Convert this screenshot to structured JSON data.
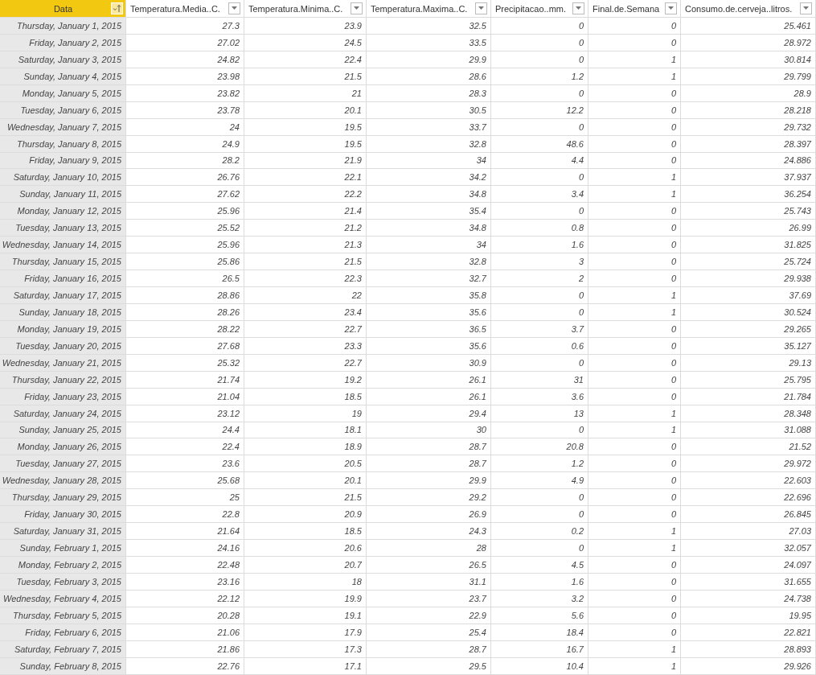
{
  "table": {
    "columns": [
      {
        "label": "Data",
        "selected": true
      },
      {
        "label": "Temperatura.Media..C.",
        "selected": false
      },
      {
        "label": "Temperatura.Minima..C.",
        "selected": false
      },
      {
        "label": "Temperatura.Maxima..C.",
        "selected": false
      },
      {
        "label": "Precipitacao..mm.",
        "selected": false
      },
      {
        "label": "Final.de.Semana",
        "selected": false
      },
      {
        "label": "Consumo.de.cerveja..litros.",
        "selected": false
      }
    ],
    "rows": [
      [
        "Thursday, January 1, 2015",
        "27.3",
        "23.9",
        "32.5",
        "0",
        "0",
        "25.461"
      ],
      [
        "Friday, January 2, 2015",
        "27.02",
        "24.5",
        "33.5",
        "0",
        "0",
        "28.972"
      ],
      [
        "Saturday, January 3, 2015",
        "24.82",
        "22.4",
        "29.9",
        "0",
        "1",
        "30.814"
      ],
      [
        "Sunday, January 4, 2015",
        "23.98",
        "21.5",
        "28.6",
        "1.2",
        "1",
        "29.799"
      ],
      [
        "Monday, January 5, 2015",
        "23.82",
        "21",
        "28.3",
        "0",
        "0",
        "28.9"
      ],
      [
        "Tuesday, January 6, 2015",
        "23.78",
        "20.1",
        "30.5",
        "12.2",
        "0",
        "28.218"
      ],
      [
        "Wednesday, January 7, 2015",
        "24",
        "19.5",
        "33.7",
        "0",
        "0",
        "29.732"
      ],
      [
        "Thursday, January 8, 2015",
        "24.9",
        "19.5",
        "32.8",
        "48.6",
        "0",
        "28.397"
      ],
      [
        "Friday, January 9, 2015",
        "28.2",
        "21.9",
        "34",
        "4.4",
        "0",
        "24.886"
      ],
      [
        "Saturday, January 10, 2015",
        "26.76",
        "22.1",
        "34.2",
        "0",
        "1",
        "37.937"
      ],
      [
        "Sunday, January 11, 2015",
        "27.62",
        "22.2",
        "34.8",
        "3.4",
        "1",
        "36.254"
      ],
      [
        "Monday, January 12, 2015",
        "25.96",
        "21.4",
        "35.4",
        "0",
        "0",
        "25.743"
      ],
      [
        "Tuesday, January 13, 2015",
        "25.52",
        "21.2",
        "34.8",
        "0.8",
        "0",
        "26.99"
      ],
      [
        "Wednesday, January 14, 2015",
        "25.96",
        "21.3",
        "34",
        "1.6",
        "0",
        "31.825"
      ],
      [
        "Thursday, January 15, 2015",
        "25.86",
        "21.5",
        "32.8",
        "3",
        "0",
        "25.724"
      ],
      [
        "Friday, January 16, 2015",
        "26.5",
        "22.3",
        "32.7",
        "2",
        "0",
        "29.938"
      ],
      [
        "Saturday, January 17, 2015",
        "28.86",
        "22",
        "35.8",
        "0",
        "1",
        "37.69"
      ],
      [
        "Sunday, January 18, 2015",
        "28.26",
        "23.4",
        "35.6",
        "0",
        "1",
        "30.524"
      ],
      [
        "Monday, January 19, 2015",
        "28.22",
        "22.7",
        "36.5",
        "3.7",
        "0",
        "29.265"
      ],
      [
        "Tuesday, January 20, 2015",
        "27.68",
        "23.3",
        "35.6",
        "0.6",
        "0",
        "35.127"
      ],
      [
        "Wednesday, January 21, 2015",
        "25.32",
        "22.7",
        "30.9",
        "0",
        "0",
        "29.13"
      ],
      [
        "Thursday, January 22, 2015",
        "21.74",
        "19.2",
        "26.1",
        "31",
        "0",
        "25.795"
      ],
      [
        "Friday, January 23, 2015",
        "21.04",
        "18.5",
        "26.1",
        "3.6",
        "0",
        "21.784"
      ],
      [
        "Saturday, January 24, 2015",
        "23.12",
        "19",
        "29.4",
        "13",
        "1",
        "28.348"
      ],
      [
        "Sunday, January 25, 2015",
        "24.4",
        "18.1",
        "30",
        "0",
        "1",
        "31.088"
      ],
      [
        "Monday, January 26, 2015",
        "22.4",
        "18.9",
        "28.7",
        "20.8",
        "0",
        "21.52"
      ],
      [
        "Tuesday, January 27, 2015",
        "23.6",
        "20.5",
        "28.7",
        "1.2",
        "0",
        "29.972"
      ],
      [
        "Wednesday, January 28, 2015",
        "25.68",
        "20.1",
        "29.9",
        "4.9",
        "0",
        "22.603"
      ],
      [
        "Thursday, January 29, 2015",
        "25",
        "21.5",
        "29.2",
        "0",
        "0",
        "22.696"
      ],
      [
        "Friday, January 30, 2015",
        "22.8",
        "20.9",
        "26.9",
        "0",
        "0",
        "26.845"
      ],
      [
        "Saturday, January 31, 2015",
        "21.64",
        "18.5",
        "24.3",
        "0.2",
        "1",
        "27.03"
      ],
      [
        "Sunday, February 1, 2015",
        "24.16",
        "20.6",
        "28",
        "0",
        "1",
        "32.057"
      ],
      [
        "Monday, February 2, 2015",
        "22.48",
        "20.7",
        "26.5",
        "4.5",
        "0",
        "24.097"
      ],
      [
        "Tuesday, February 3, 2015",
        "23.16",
        "18",
        "31.1",
        "1.6",
        "0",
        "31.655"
      ],
      [
        "Wednesday, February 4, 2015",
        "22.12",
        "19.9",
        "23.7",
        "3.2",
        "0",
        "24.738"
      ],
      [
        "Thursday, February 5, 2015",
        "20.28",
        "19.1",
        "22.9",
        "5.6",
        "0",
        "19.95"
      ],
      [
        "Friday, February 6, 2015",
        "21.06",
        "17.9",
        "25.4",
        "18.4",
        "0",
        "22.821"
      ],
      [
        "Saturday, February 7, 2015",
        "21.86",
        "17.3",
        "28.7",
        "16.7",
        "1",
        "28.893"
      ],
      [
        "Sunday, February 8, 2015",
        "22.76",
        "17.1",
        "29.5",
        "10.4",
        "1",
        "29.926"
      ]
    ]
  }
}
